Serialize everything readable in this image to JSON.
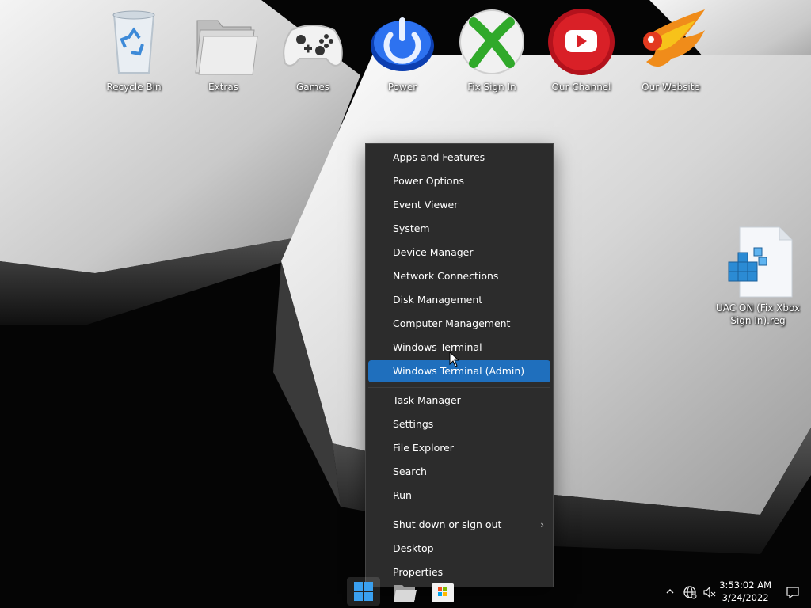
{
  "desktop": {
    "icons": [
      {
        "label": "Recycle Bin",
        "icon": "recycle-bin-icon"
      },
      {
        "label": "Extras",
        "icon": "folder-icon"
      },
      {
        "label": "Games",
        "icon": "gamepad-icon"
      },
      {
        "label": "Power",
        "icon": "power-icon"
      },
      {
        "label": "Fix Sign In",
        "icon": "xbox-icon"
      },
      {
        "label": "Our Channel",
        "icon": "youtube-icon"
      },
      {
        "label": "Our Website",
        "icon": "phoenix-logo-icon"
      }
    ],
    "file": {
      "label": "UAC ON (Fix Xbox Sign In).reg",
      "icon": "registry-file-icon"
    }
  },
  "menu": {
    "items": [
      {
        "label": "Apps and Features"
      },
      {
        "label": "Power Options"
      },
      {
        "label": "Event Viewer"
      },
      {
        "label": "System"
      },
      {
        "label": "Device Manager"
      },
      {
        "label": "Network Connections"
      },
      {
        "label": "Disk Management"
      },
      {
        "label": "Computer Management"
      },
      {
        "label": "Windows Terminal"
      },
      {
        "label": "Windows Terminal (Admin)",
        "highlighted": true
      },
      {
        "label": "Task Manager"
      },
      {
        "label": "Settings"
      },
      {
        "label": "File Explorer"
      },
      {
        "label": "Search"
      },
      {
        "label": "Run"
      },
      {
        "label": "Shut down or sign out",
        "submenu": true
      },
      {
        "label": "Desktop"
      },
      {
        "label": "Properties"
      }
    ],
    "submenu_glyph": "›"
  },
  "taskbar": {
    "clock": {
      "time": "3:53:02 AM",
      "date": "3/24/2022"
    },
    "tray_icons": [
      "chevron-up-icon",
      "network-icon",
      "volume-muted-icon",
      "notification-icon"
    ]
  },
  "colors": {
    "accent": "#1f6fbd",
    "menu_bg": "#2c2c2c"
  }
}
